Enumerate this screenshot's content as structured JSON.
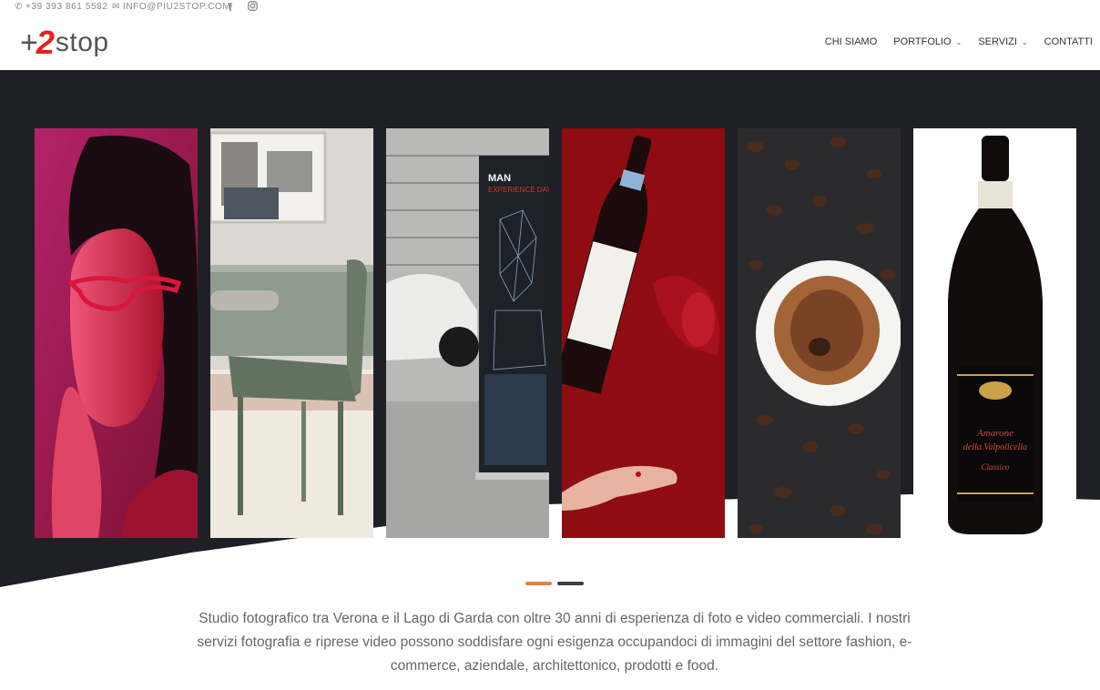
{
  "topbar": {
    "phone": "+39 393 861 5582",
    "email": "INFO@PIU2STOP.COM",
    "facebook_icon": "facebook-icon",
    "instagram_icon": "instagram-icon"
  },
  "logo": {
    "plus": "+",
    "two": "2",
    "stop": "stop"
  },
  "nav": [
    {
      "label": "CHI SIAMO",
      "dropdown": false
    },
    {
      "label": "PORTFOLIO",
      "dropdown": true
    },
    {
      "label": "SERVIZI",
      "dropdown": true
    },
    {
      "label": "CONTATTI",
      "dropdown": false
    }
  ],
  "slider": {
    "panels": [
      {
        "subject": "fashion portrait"
      },
      {
        "subject": "chair interior"
      },
      {
        "subject": "event roll-up stand"
      },
      {
        "subject": "red wine bottle"
      },
      {
        "subject": "coffee cup and beans"
      },
      {
        "subject": "amarone wine bottle"
      }
    ],
    "banner_text": {
      "man": "MAN",
      "experience": "EXPERIENCE DAY"
    },
    "label_text": {
      "line1": "Amarone",
      "line2": "della Valpolicella",
      "line3": "Classico"
    },
    "dots": 2,
    "active_dot": 0
  },
  "colors": {
    "accent": "#e2833f",
    "dark": "#1f2026",
    "brand_red": "#e2221c"
  },
  "description": "Studio fotografico tra Verona e il Lago di Garda con oltre 30 anni di esperienza di foto e video commerciali. I nostri servizi fotografia e riprese video possono soddisfare ogni esigenza occupandoci di immagini del settore fashion, e-commerce, aziendale, architettonico, prodotti e food."
}
